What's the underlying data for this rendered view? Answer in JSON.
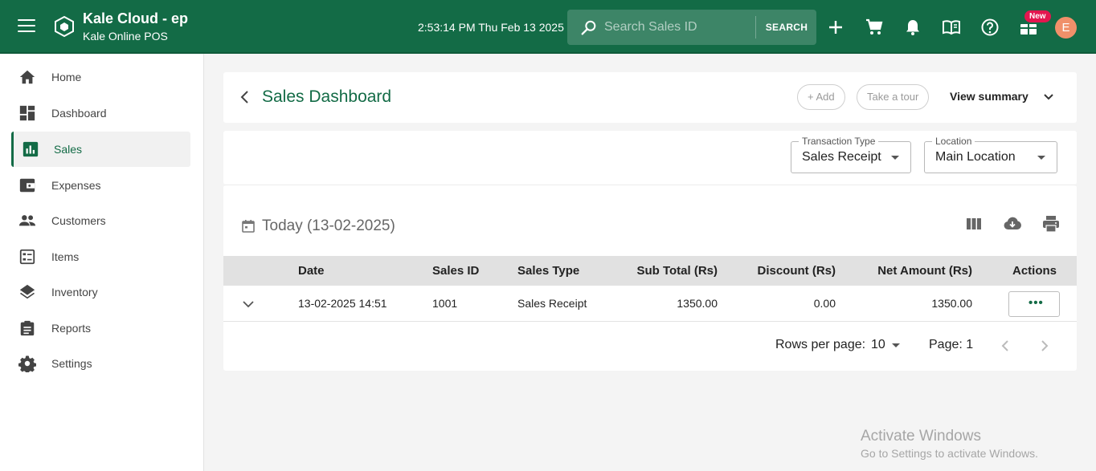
{
  "topbar": {
    "brand_title": "Kale Cloud - ep",
    "brand_subtitle": "Kale Online POS",
    "datetime": "2:53:14 PM Thu Feb 13 2025",
    "search_placeholder": "Search Sales ID",
    "search_button": "SEARCH",
    "new_badge": "New",
    "avatar_initial": "E",
    "icons": [
      "menu-icon",
      "logo-icon",
      "search-icon",
      "plus-icon",
      "cart-icon",
      "bell-icon",
      "book-icon",
      "help-icon",
      "gift-icon"
    ],
    "colors": {
      "bar": "#136b46",
      "badge": "#e3164f",
      "avatar": "#f0906a"
    }
  },
  "sidebar": {
    "items": [
      {
        "label": "Home",
        "icon": "home-icon"
      },
      {
        "label": "Dashboard",
        "icon": "dashboard-icon"
      },
      {
        "label": "Sales",
        "icon": "bar-chart-icon",
        "active": true
      },
      {
        "label": "Expenses",
        "icon": "wallet-icon"
      },
      {
        "label": "Customers",
        "icon": "people-icon"
      },
      {
        "label": "Items",
        "icon": "list-icon"
      },
      {
        "label": "Inventory",
        "icon": "layers-icon"
      },
      {
        "label": "Reports",
        "icon": "clipboard-icon"
      },
      {
        "label": "Settings",
        "icon": "gear-icon"
      }
    ]
  },
  "header": {
    "title": "Sales Dashboard",
    "add_label": "+ Add",
    "tour_label": "Take a tour",
    "view_summary_label": "View summary"
  },
  "filters": {
    "transaction_type": {
      "label": "Transaction Type",
      "value": "Sales Receipt"
    },
    "location": {
      "label": "Location",
      "value": "Main Location"
    }
  },
  "table": {
    "date_heading": "Today (13-02-2025)",
    "columns": [
      "Date",
      "Sales ID",
      "Sales Type",
      "Sub Total (Rs)",
      "Discount (Rs)",
      "Net Amount (Rs)",
      "Actions"
    ],
    "rows": [
      {
        "date": "13-02-2025 14:51",
        "sales_id": "1001",
        "sales_type": "Sales Receipt",
        "sub_total": "1350.00",
        "discount": "0.00",
        "net_amount": "1350.00",
        "actions": "•••"
      }
    ],
    "rows_per_page_label": "Rows per page:",
    "rows_per_page_value": "10",
    "page_label": "Page: 1"
  },
  "watermark": {
    "title": "Activate Windows",
    "subtitle": "Go to Settings to activate Windows."
  }
}
